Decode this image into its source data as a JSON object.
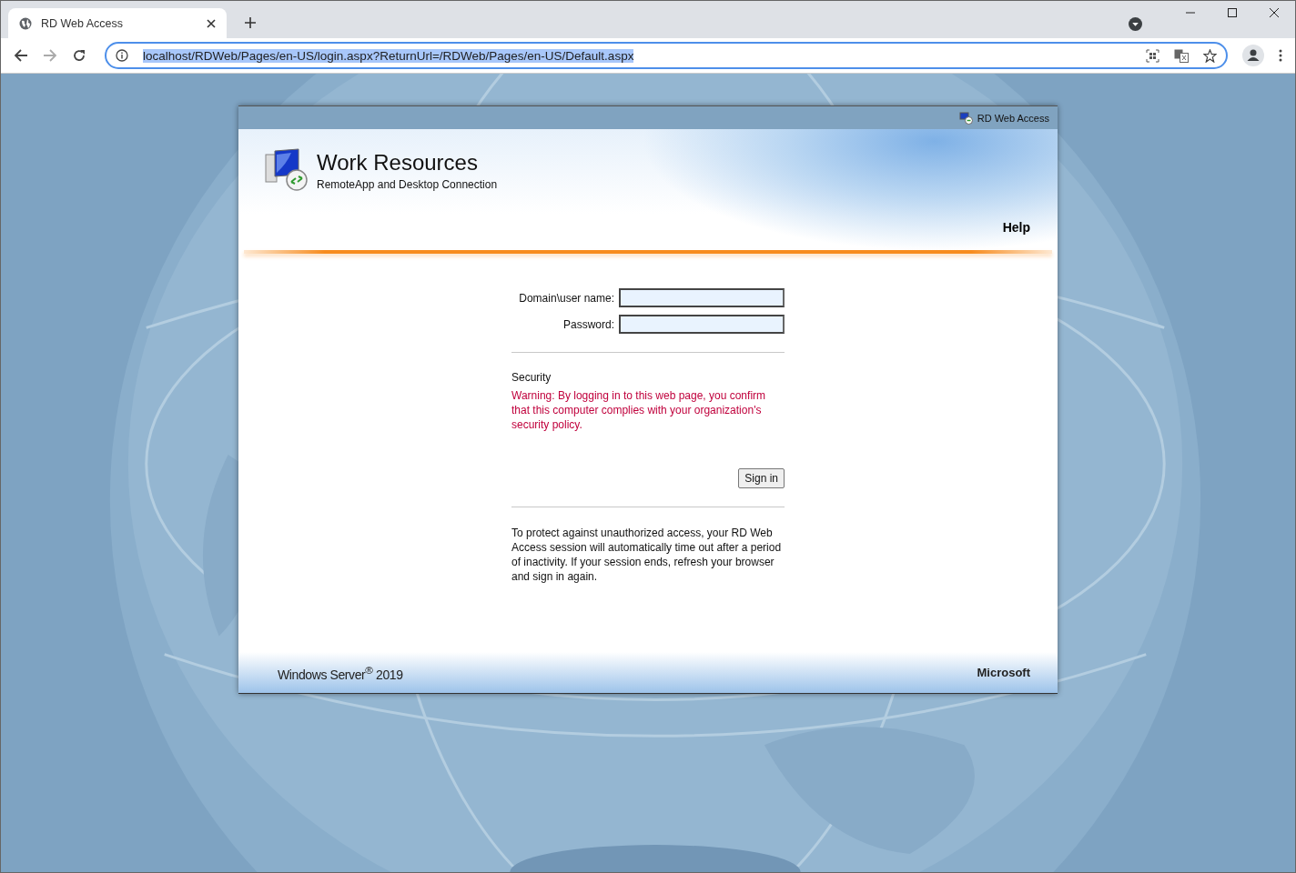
{
  "browser": {
    "tabs": [
      {
        "title": "RD Web Access",
        "selected": true
      }
    ],
    "address": "localhost/RDWeb/Pages/en-US/login.aspx?ReturnUrl=/RDWeb/Pages/en-US/Default.aspx",
    "address_selected": true
  },
  "page": {
    "top_bar_label": "RD Web Access",
    "title": "Work Resources",
    "subtitle": "RemoteApp and Desktop Connection",
    "help_link": "Help",
    "fields": [
      {
        "label": "Domain\\user name:"
      },
      {
        "label": "Password:"
      }
    ],
    "security_heading": "Security",
    "warning": "Warning: By logging in to this web page, you confirm that this computer complies with your organization's security policy.",
    "sign_in_button": "Sign in",
    "timeout_note": "To protect against unauthorized access, your RD Web Access session will automatically time out after a period of inactivity. If your session ends, refresh your browser and sign in again.",
    "footer_product": "Windows Server$^{®}$ 2019",
    "footer_brand": "Microsoft"
  }
}
